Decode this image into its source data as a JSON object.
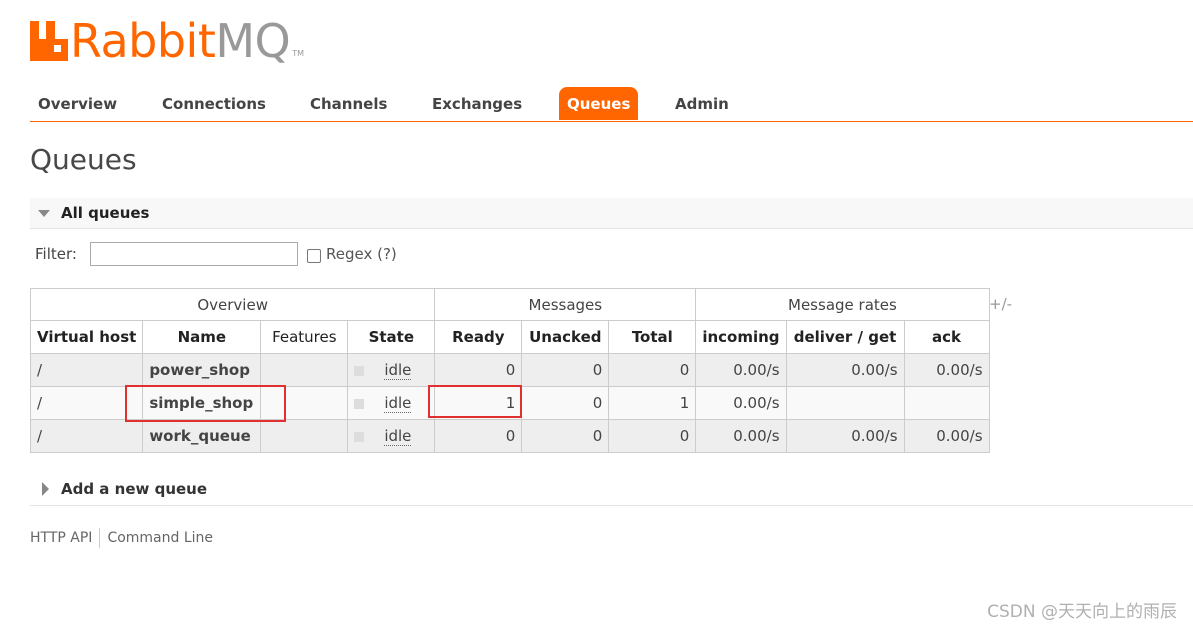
{
  "logo": {
    "brand": "Rabbit",
    "suffix": "MQ",
    "tm": "TM"
  },
  "nav": [
    {
      "label": "Overview"
    },
    {
      "label": "Connections"
    },
    {
      "label": "Channels"
    },
    {
      "label": "Exchanges"
    },
    {
      "label": "Queues",
      "active": true
    },
    {
      "label": "Admin"
    }
  ],
  "page_title": "Queues",
  "section_all": "All queues",
  "filter": {
    "label": "Filter:",
    "value": "",
    "regex_label": "Regex (?)"
  },
  "table": {
    "groups": [
      "Overview",
      "Messages",
      "Message rates"
    ],
    "columns": [
      "Virtual host",
      "Name",
      "Features",
      "State",
      "Ready",
      "Unacked",
      "Total",
      "incoming",
      "deliver / get",
      "ack"
    ],
    "toggle": "+/-",
    "rows": [
      {
        "vhost": "/",
        "name": "power_shop",
        "features": "",
        "state": "idle",
        "ready": "0",
        "unacked": "0",
        "total": "0",
        "incoming": "0.00/s",
        "deliver": "0.00/s",
        "ack": "0.00/s"
      },
      {
        "vhost": "/",
        "name": "simple_shop",
        "features": "",
        "state": "idle",
        "ready": "1",
        "unacked": "0",
        "total": "1",
        "incoming": "0.00/s",
        "deliver": "",
        "ack": ""
      },
      {
        "vhost": "/",
        "name": "work_queue",
        "features": "",
        "state": "idle",
        "ready": "0",
        "unacked": "0",
        "total": "0",
        "incoming": "0.00/s",
        "deliver": "0.00/s",
        "ack": "0.00/s"
      }
    ]
  },
  "section_add": "Add a new queue",
  "footer": [
    "HTTP API",
    "Command Line"
  ],
  "watermark": "CSDN @天天向上的雨辰",
  "colors": {
    "accent": "#ff6600",
    "highlight": "#e03030"
  }
}
